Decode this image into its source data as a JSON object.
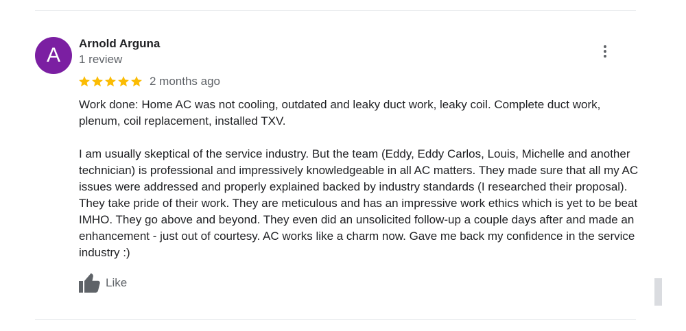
{
  "review": {
    "avatar_letter": "A",
    "avatar_color": "#7b1fa2",
    "author_name": "Arnold Arguna",
    "review_count": "1 review",
    "rating": 5,
    "rating_max": 5,
    "star_color": "#fbbc04",
    "date": "2 months ago",
    "paragraphs": [
      "Work done: Home AC was not cooling, outdated and leaky duct work, leaky coil. Complete duct work, plenum, coil replacement, installed TXV.",
      "I am usually skeptical of the service industry. But the team (Eddy, Eddy Carlos, Louis, Michelle and another technician) is professional and impressively knowledgeable in all AC matters. They made sure that all my AC issues were addressed and properly explained backed by industry standards (I researched their proposal). They take pride of their work. They are meticulous and has an impressive work ethics which is yet to be beat IMHO. They go above and beyond. They even did an unsolicited follow-up a couple days after and made an enhancement - just out of courtesy.  AC works like a charm now. Gave me back my confidence in the service industry :)"
    ],
    "like_label": "Like",
    "more_icon": "more-vert-icon",
    "like_icon": "thumb-up-icon"
  }
}
